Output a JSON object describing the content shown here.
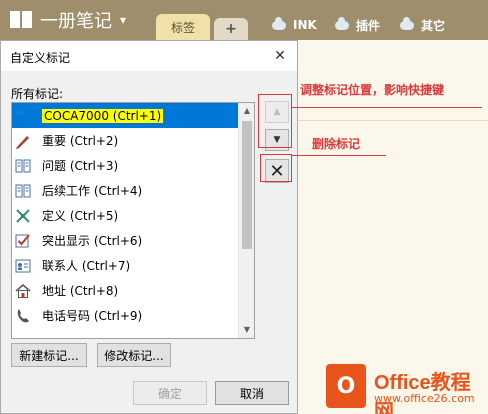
{
  "app": {
    "title": "一册笔记",
    "caret": "▾",
    "tabs": [
      {
        "label": "标签"
      },
      {
        "label": "+"
      }
    ],
    "top_links": [
      {
        "label": "INK"
      },
      {
        "label": "插件"
      },
      {
        "label": "其它"
      }
    ]
  },
  "dialog": {
    "title": "自定义标记",
    "close_glyph": "✕",
    "list_label": "所有标记:",
    "items": [
      {
        "label": "COCA7000 (Ctrl+1)",
        "icon": "quote-icon",
        "selected": true
      },
      {
        "label": "重要 (Ctrl+2)",
        "icon": "pen-icon"
      },
      {
        "label": "问题 (Ctrl+3)",
        "icon": "book-icon"
      },
      {
        "label": "后续工作 (Ctrl+4)",
        "icon": "book-icon"
      },
      {
        "label": "定义 (Ctrl+5)",
        "icon": "cross-pattern-icon"
      },
      {
        "label": "突出显示 (Ctrl+6)",
        "icon": "checkbox-icon"
      },
      {
        "label": "联系人 (Ctrl+7)",
        "icon": "contact-card-icon"
      },
      {
        "label": "地址 (Ctrl+8)",
        "icon": "house-icon"
      },
      {
        "label": "电话号码 (Ctrl+9)",
        "icon": "phone-icon"
      }
    ],
    "move_up_glyph": "▲",
    "move_down_glyph": "▼",
    "delete_glyph": "✕",
    "new_button": "新建标记...",
    "modify_button": "修改标记...",
    "ok_button": "确定",
    "cancel_button": "取消"
  },
  "annotations": {
    "reorder_note": "调整标记位置，影响快捷键",
    "delete_note": "删除标记"
  },
  "watermark": {
    "logo_letter": "O",
    "name": "Office教程网",
    "url": "www.office26.com"
  },
  "colors": {
    "app_bar": "#9e8e6c",
    "selection": "#0078d7",
    "highlight": "#ffff00",
    "annotation": "#d93b3b",
    "brand": "#e8541b"
  }
}
